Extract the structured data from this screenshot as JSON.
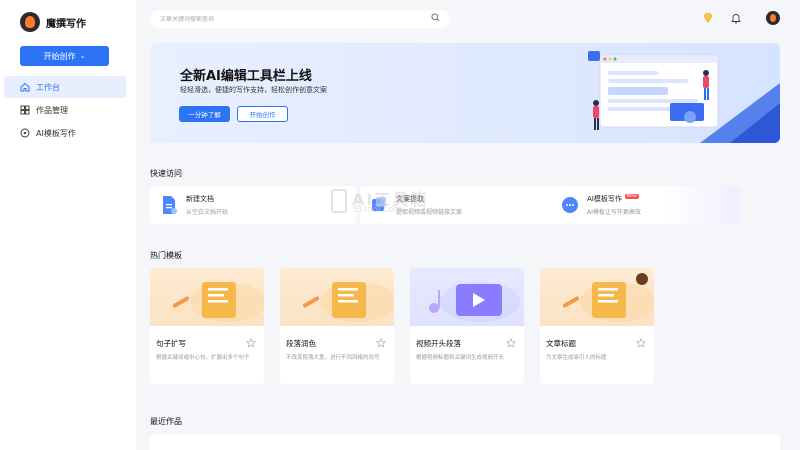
{
  "sidebar": {
    "brand": "魔撰写作",
    "start_button": "开始创作",
    "items": [
      {
        "label": "工作台",
        "icon": "home-icon",
        "active": true
      },
      {
        "label": "作品管理",
        "icon": "grid-icon",
        "active": false
      },
      {
        "label": "AI模板写作",
        "icon": "compass-icon",
        "active": false
      }
    ]
  },
  "header": {
    "search_placeholder": "文章关键词搜索查询"
  },
  "banner": {
    "title": "全新AI编辑工具栏上线",
    "subtitle": "轻轻滑选，便捷的写作支持，轻松创作创意文案",
    "primary_button": "一分钟了解",
    "secondary_button": "开始创作"
  },
  "quick_access": {
    "title": "快速访问",
    "items": [
      {
        "title": "新建文档",
        "subtitle": "从空白文档开始"
      },
      {
        "title": "文案提取",
        "subtitle": "提取视频或视频链接文案"
      },
      {
        "title": "AI模板写作",
        "subtitle": "AI模板让写作更高效",
        "badge": "New"
      }
    ]
  },
  "templates": {
    "title": "热门模板",
    "items": [
      {
        "name": "句子扩写",
        "desc": "根据关键词或中心句，扩展出多个句子"
      },
      {
        "name": "段落润色",
        "desc": "不改变段落大意，进行不同风格的改写"
      },
      {
        "name": "视频开头段落",
        "desc": "根据视频标题和关键词生成视频开头"
      },
      {
        "name": "文章标题",
        "desc": "为文章生成吸引人的标题"
      }
    ]
  },
  "recent": {
    "title": "最近作品"
  },
  "watermark": {
    "big": "AI工具箱",
    "small": "51tool.com"
  },
  "colors": {
    "accent": "#2d73f5",
    "active_bg": "#e7efff",
    "badge": "#ff4d4f"
  }
}
